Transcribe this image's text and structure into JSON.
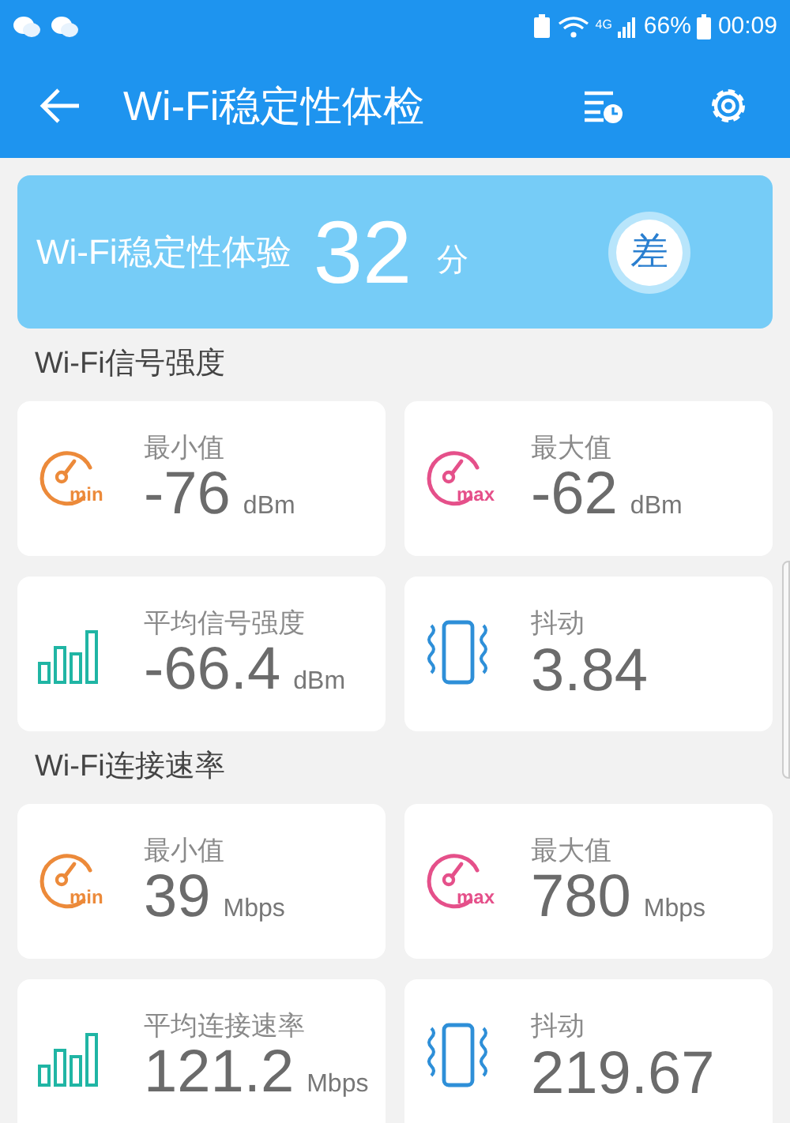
{
  "status_bar": {
    "network_label": "4G",
    "battery": "66%",
    "time": "00:09"
  },
  "header": {
    "title": "Wi-Fi稳定性体检"
  },
  "score_card": {
    "label": "Wi-Fi稳定性体验",
    "score": "32",
    "unit": "分",
    "grade": "差"
  },
  "sections": [
    {
      "title": "Wi-Fi信号强度",
      "metrics": [
        {
          "kind": "min",
          "icon_label": "min",
          "label": "最小值",
          "value": "-76",
          "unit": "dBm"
        },
        {
          "kind": "max",
          "icon_label": "max",
          "label": "最大值",
          "value": "-62",
          "unit": "dBm"
        },
        {
          "kind": "average",
          "label": "平均信号强度",
          "value": "-66.4",
          "unit": "dBm"
        },
        {
          "kind": "jitter",
          "label": "抖动",
          "value": "3.84"
        }
      ]
    },
    {
      "title": "Wi-Fi连接速率",
      "metrics": [
        {
          "kind": "min",
          "icon_label": "min",
          "label": "最小值",
          "value": "39",
          "unit": "Mbps"
        },
        {
          "kind": "max",
          "icon_label": "max",
          "label": "最大值",
          "value": "780",
          "unit": "Mbps"
        },
        {
          "kind": "average",
          "label": "平均连接速率",
          "value": "121.2",
          "unit": "Mbps"
        },
        {
          "kind": "jitter",
          "label": "抖动",
          "value": "219.67"
        }
      ]
    }
  ]
}
